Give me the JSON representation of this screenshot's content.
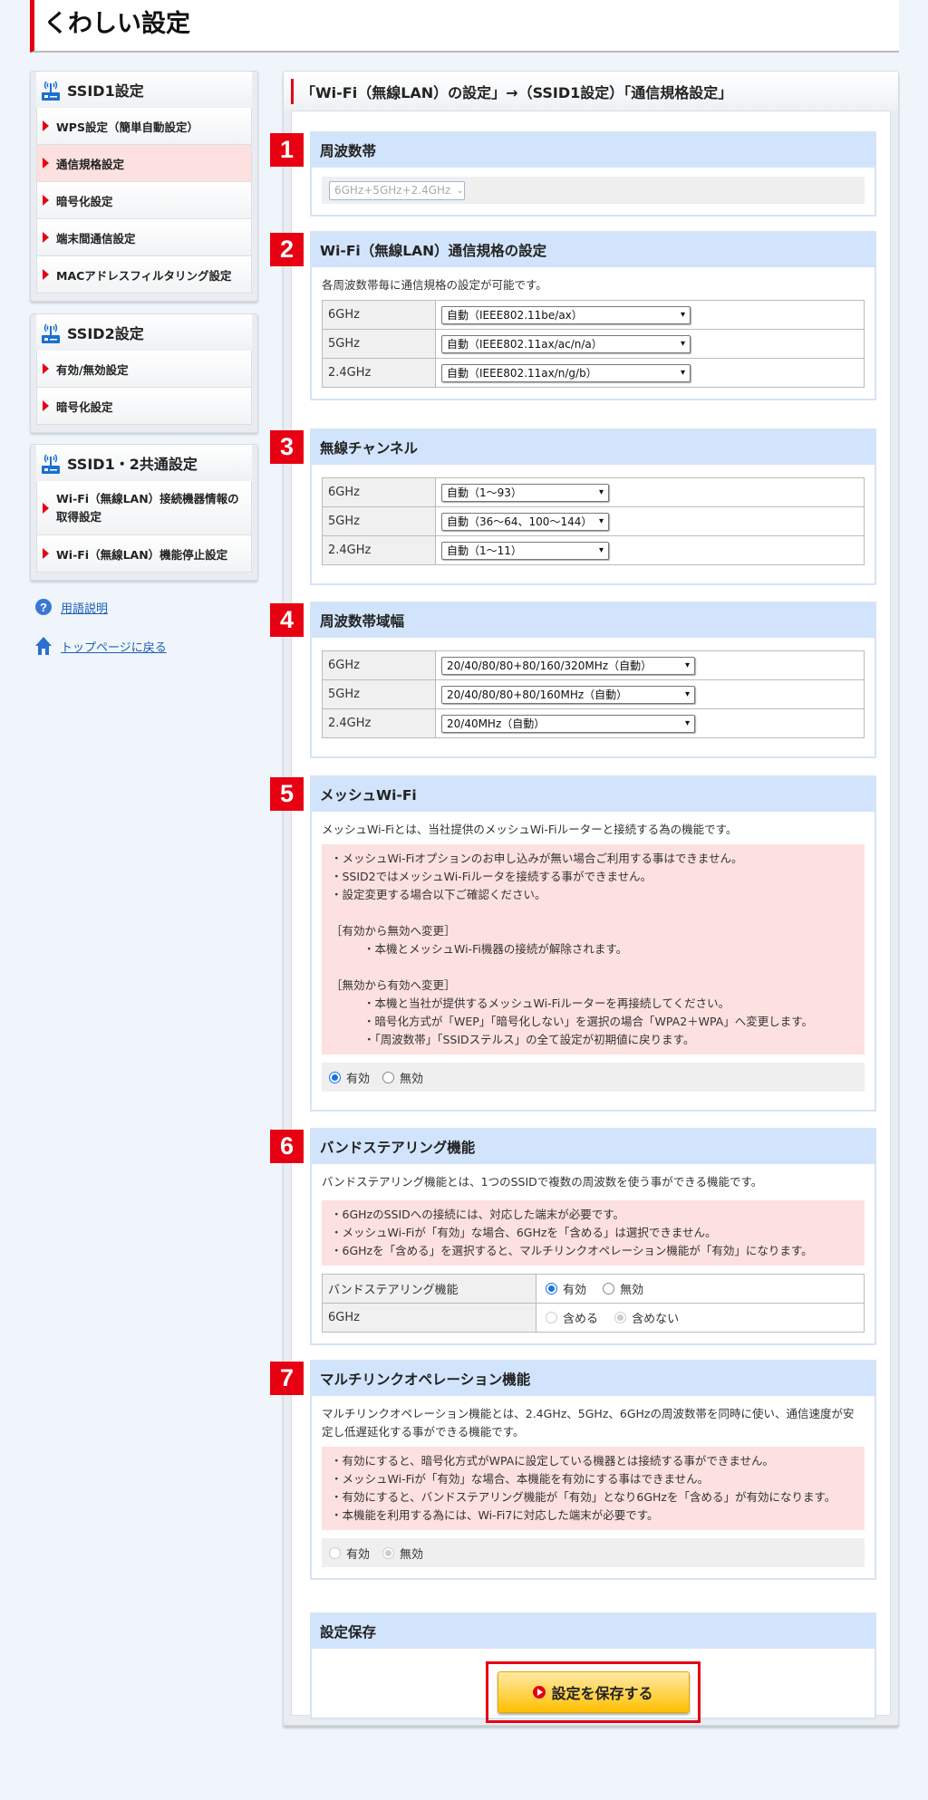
{
  "page_title": "くわしい設定",
  "sidebar": {
    "groups": [
      {
        "title": "SSID1設定",
        "items": [
          "WPS設定（簡単自動設定）",
          "通信規格設定",
          "暗号化設定",
          "端末間通信設定",
          "MACアドレスフィルタリング設定"
        ],
        "active": 1
      },
      {
        "title": "SSID2設定",
        "items": [
          "有効/無効設定",
          "暗号化設定"
        ]
      },
      {
        "title": "SSID1・2共通設定",
        "items": [
          "Wi-Fi（無線LAN）接続機器情報の取得設定",
          "Wi-Fi（無線LAN）機能停止設定"
        ]
      }
    ],
    "links": {
      "glossary": "用語説明",
      "top": "トップページに戻る"
    }
  },
  "main": {
    "title": "「Wi-Fi（無線LAN）の設定」→（SSID1設定）「通信規格設定」",
    "sections": {
      "s1": {
        "num": "1",
        "title": "周波数帯",
        "select": "6GHz+5GHz+2.4GHz"
      },
      "s2": {
        "num": "2",
        "title": "Wi-Fi（無線LAN）通信規格の設定",
        "desc": "各周波数帯毎に通信規格の設定が可能です。",
        "rows": [
          {
            "label": "6GHz",
            "value": "自動（IEEE802.11be/ax）"
          },
          {
            "label": "5GHz",
            "value": "自動（IEEE802.11ax/ac/n/a）"
          },
          {
            "label": "2.4GHz",
            "value": "自動（IEEE802.11ax/n/g/b）"
          }
        ]
      },
      "s3": {
        "num": "3",
        "title": "無線チャンネル",
        "rows": [
          {
            "label": "6GHz",
            "value": "自動（1～93）"
          },
          {
            "label": "5GHz",
            "value": "自動（36～64、100～144）"
          },
          {
            "label": "2.4GHz",
            "value": "自動（1～11）"
          }
        ]
      },
      "s4": {
        "num": "4",
        "title": "周波数帯域幅",
        "rows": [
          {
            "label": "6GHz",
            "value": "20/40/80/80+80/160/320MHz（自動）"
          },
          {
            "label": "5GHz",
            "value": "20/40/80/80+80/160MHz（自動）"
          },
          {
            "label": "2.4GHz",
            "value": "20/40MHz（自動）"
          }
        ]
      },
      "s5": {
        "num": "5",
        "title": "メッシュWi-Fi",
        "desc": "メッシュWi-Fiとは、当社提供のメッシュWi-Fiルーターと接続する為の機能です。",
        "notes": [
          "・メッシュWi-Fiオプションのお申し込みが無い場合ご利用する事はできません。",
          "・SSID2ではメッシュWi-Fiルータを接続する事ができません。",
          "・設定変更する場合以下ご確認ください。"
        ],
        "on_to_off_head": "［有効から無効へ変更］",
        "on_to_off": [
          "・本機とメッシュWi-Fi機器の接続が解除されます。"
        ],
        "off_to_on_head": "［無効から有効へ変更］",
        "off_to_on": [
          "・本機と当社が提供するメッシュWi-Fiルーターを再接続してください。",
          "・暗号化方式が「WEP」「暗号化しない」を選択の場合「WPA2＋WPA」へ変更します。",
          "・「周波数帯」「SSIDステルス」の全て設定が初期値に戻ります。"
        ],
        "options": [
          "有効",
          "無効"
        ],
        "selected": "有効"
      },
      "s6": {
        "num": "6",
        "title": "バンドステアリング機能",
        "desc": "バンドステアリング機能とは、1つのSSIDで複数の周波数を使う事ができる機能です。",
        "notes": [
          "・6GHzのSSIDへの接続には、対応した端末が必要です。",
          "・メッシュWi-Fiが「有効」な場合、6GHzを「含める」は選択できません。",
          "・6GHzを「含める」を選択すると、マルチリンクオペレーション機能が「有効」になります。"
        ],
        "rows": [
          {
            "label": "バンドステアリング機能",
            "options": [
              "有効",
              "無効"
            ],
            "selected": "有効"
          },
          {
            "label": "6GHz",
            "options": [
              "含める",
              "含めない"
            ],
            "selected": "含めない"
          }
        ]
      },
      "s7": {
        "num": "7",
        "title": "マルチリンクオペレーション機能",
        "desc": "マルチリンクオペレーション機能とは、2.4GHz、5GHz、6GHzの周波数帯を同時に使い、通信速度が安定し低遅延化する事ができる機能です。",
        "notes": [
          "・有効にすると、暗号化方式がWPAに設定している機器とは接続する事ができません。",
          "・メッシュWi-Fiが「有効」な場合、本機能を有効にする事はできません。",
          "・有効にすると、バンドステアリング機能が「有効」となり6GHzを「含める」が有効になります。",
          "・本機能を利用する為には、Wi-Fi7に対応した端末が必要です。"
        ],
        "options": [
          "有効",
          "無効"
        ],
        "selected": "無効"
      },
      "save": {
        "title": "設定保存",
        "button": "設定を保存する"
      }
    }
  },
  "colors": {
    "accent": "#e60012",
    "section_header": "#d1e4fb",
    "note_bg": "#fde0e0",
    "button": "#ffd34d"
  }
}
